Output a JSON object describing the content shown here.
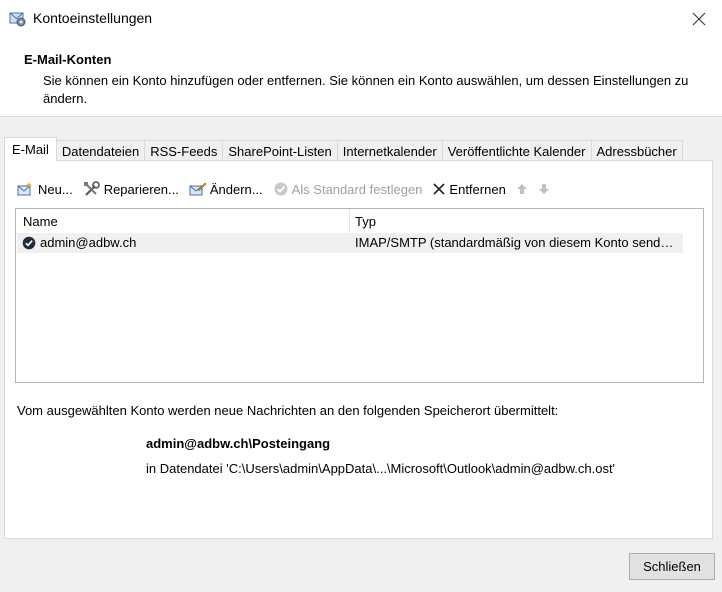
{
  "window": {
    "title": "Kontoeinstellungen",
    "icon": "mail-settings-icon"
  },
  "header": {
    "heading": "E-Mail-Konten",
    "description": "Sie können ein Konto hinzufügen oder entfernen. Sie können ein Konto auswählen, um dessen Einstellungen zu ändern."
  },
  "tabs": [
    {
      "label": "E-Mail",
      "active": true
    },
    {
      "label": "Datendateien",
      "active": false
    },
    {
      "label": "RSS-Feeds",
      "active": false
    },
    {
      "label": "SharePoint-Listen",
      "active": false
    },
    {
      "label": "Internetkalender",
      "active": false
    },
    {
      "label": "Veröffentlichte Kalender",
      "active": false
    },
    {
      "label": "Adressbücher",
      "active": false
    }
  ],
  "toolbar": {
    "new": {
      "label": "Neu...",
      "icon": "new-account-icon"
    },
    "repair": {
      "label": "Reparieren...",
      "icon": "repair-tools-icon"
    },
    "change": {
      "label": "Ändern...",
      "icon": "change-account-icon"
    },
    "set_default": {
      "label": "Als Standard festlegen",
      "icon": "check-circle-icon",
      "disabled": true
    },
    "remove": {
      "label": "Entfernen",
      "icon": "close-x-icon"
    },
    "move_up": {
      "icon": "arrow-up-icon",
      "disabled": true
    },
    "move_down": {
      "icon": "arrow-down-icon",
      "disabled": true
    }
  },
  "list": {
    "columns": [
      "Name",
      "Typ"
    ],
    "rows": [
      {
        "name": "admin@adbw.ch",
        "type": "IMAP/SMTP (standardmäßig von diesem Konto send…",
        "default": true,
        "selected": true
      }
    ]
  },
  "delivery": {
    "info": "Vom ausgewählten Konto werden neue Nachrichten an den folgenden Speicherort übermittelt:",
    "folder": "admin@adbw.ch\\Posteingang",
    "file": "in Datendatei 'C:\\Users\\admin\\AppData\\...\\Microsoft\\Outlook\\admin@adbw.ch.ost'"
  },
  "footer": {
    "close_label": "Schließen"
  }
}
